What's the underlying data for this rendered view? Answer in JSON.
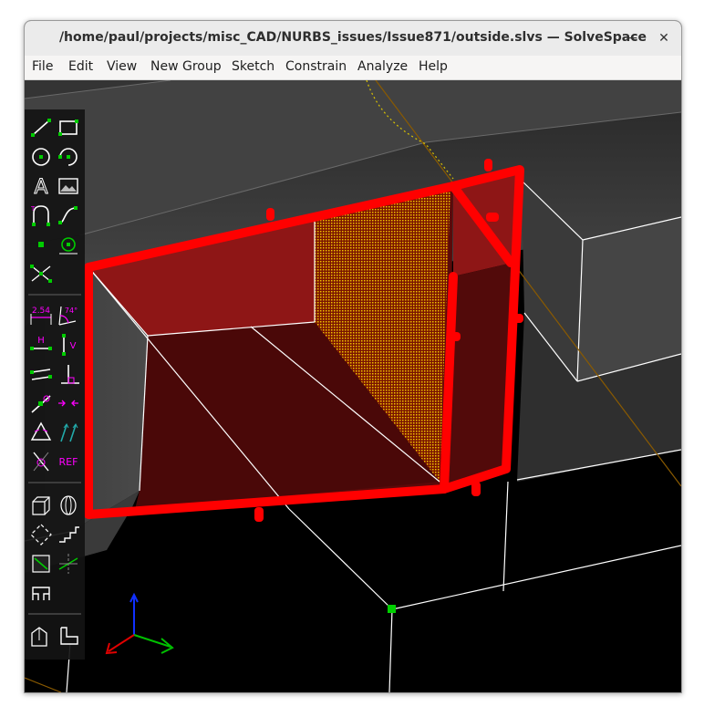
{
  "window": {
    "title": "/home/paul/projects/misc_CAD/NURBS_issues/Issue871/outside.slvs — SolveSpace",
    "minimize_glyph": "−",
    "close_glyph": "✕"
  },
  "menu": [
    "File",
    "Edit",
    "View",
    "New Group",
    "Sketch",
    "Constrain",
    "Analyze",
    "Help"
  ],
  "toolbar": {
    "dimension_text": "2.54",
    "angle_text": "74°",
    "horizontal_text": "H",
    "vertical_text": "V",
    "reference_text": "REF",
    "text_tool_glyph": "A",
    "icons": [
      "line-segment-icon",
      "rectangle-icon",
      "circle-icon",
      "arc-icon",
      "text-icon",
      "image-icon",
      "tangent-arc-icon",
      "cubic-spline-icon",
      "datum-point-icon",
      "workplane-icon",
      "split-curves-icon",
      "distance-dimension-icon",
      "angle-dimension-icon",
      "horizontal-icon",
      "vertical-icon",
      "parallel-icon",
      "perpendicular-icon",
      "point-on-icon",
      "symmetric-icon",
      "equal-icon",
      "same-orientation-icon",
      "construction-icon",
      "reference-icon",
      "extrude-icon",
      "revolve-icon",
      "lathe-icon",
      "helix-icon",
      "linked-icon",
      "section-icon",
      "workplane-group-icon",
      "step-translate-icon",
      "step-rotate-icon"
    ]
  },
  "colors": {
    "background": "#000000",
    "selection": "#ff0000",
    "hover_hatch": "#ffd400",
    "axis_x": "#e00000",
    "axis_y": "#00c000",
    "axis_z": "#0033ff",
    "constraint": "#ff00ff",
    "entity": "#ffffff",
    "point": "#00ff00"
  }
}
